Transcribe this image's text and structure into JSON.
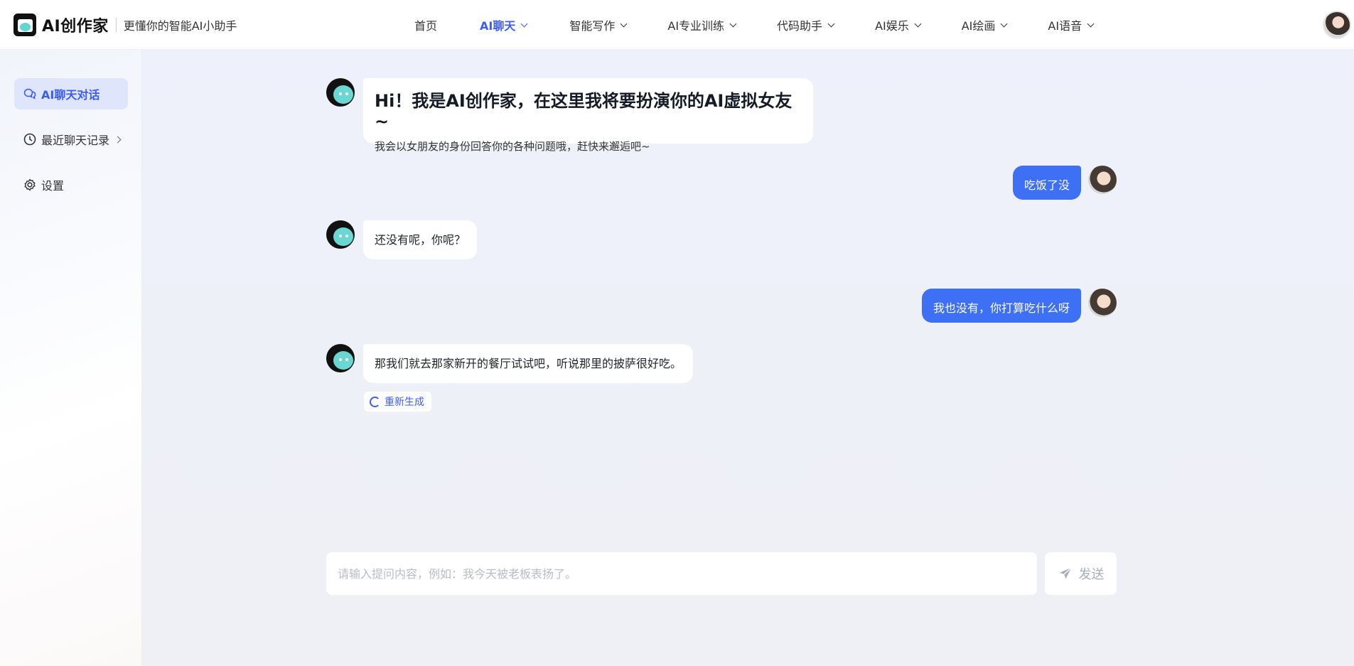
{
  "header": {
    "logo_text": "AI创作家",
    "slogan": "更懂你的智能AI小助手",
    "nav": [
      {
        "label": "首页",
        "has_dropdown": false,
        "active": false
      },
      {
        "label": "AI聊天",
        "has_dropdown": true,
        "active": true
      },
      {
        "label": "智能写作",
        "has_dropdown": true,
        "active": false
      },
      {
        "label": "AI专业训练",
        "has_dropdown": true,
        "active": false
      },
      {
        "label": "代码助手",
        "has_dropdown": true,
        "active": false
      },
      {
        "label": "AI娱乐",
        "has_dropdown": true,
        "active": false
      },
      {
        "label": "AI绘画",
        "has_dropdown": true,
        "active": false
      },
      {
        "label": "AI语音",
        "has_dropdown": true,
        "active": false
      }
    ]
  },
  "sidebar": {
    "items": [
      {
        "label": "AI聊天对话",
        "icon": "chat-icon",
        "active": true
      },
      {
        "label": "最近聊天记录",
        "icon": "clock-icon",
        "active": false
      },
      {
        "label": "设置",
        "icon": "gear-icon",
        "active": false
      }
    ]
  },
  "chat": {
    "greeting_title": "Hi！我是AI创作家，在这里我将要扮演你的AI虚拟女友~",
    "greeting_sub": "我会以女朋友的身份回答你的各种问题哦，赶快来邂逅吧~",
    "messages": [
      {
        "role": "user",
        "text": "吃饭了没"
      },
      {
        "role": "bot",
        "text": "还没有呢，你呢？"
      },
      {
        "role": "user",
        "text": "我也没有，你打算吃什么呀"
      },
      {
        "role": "bot",
        "text": "那我们就去那家新开的餐厅试试吧，听说那里的披萨很好吃。"
      }
    ],
    "regenerate_label": "重新生成"
  },
  "composer": {
    "placeholder": "请输入提问内容，例如：我今天被老板表扬了。",
    "value": "",
    "send_label": "发送"
  },
  "colors": {
    "accent": "#3d5cf5",
    "user_bubble": "#3d70f5"
  }
}
